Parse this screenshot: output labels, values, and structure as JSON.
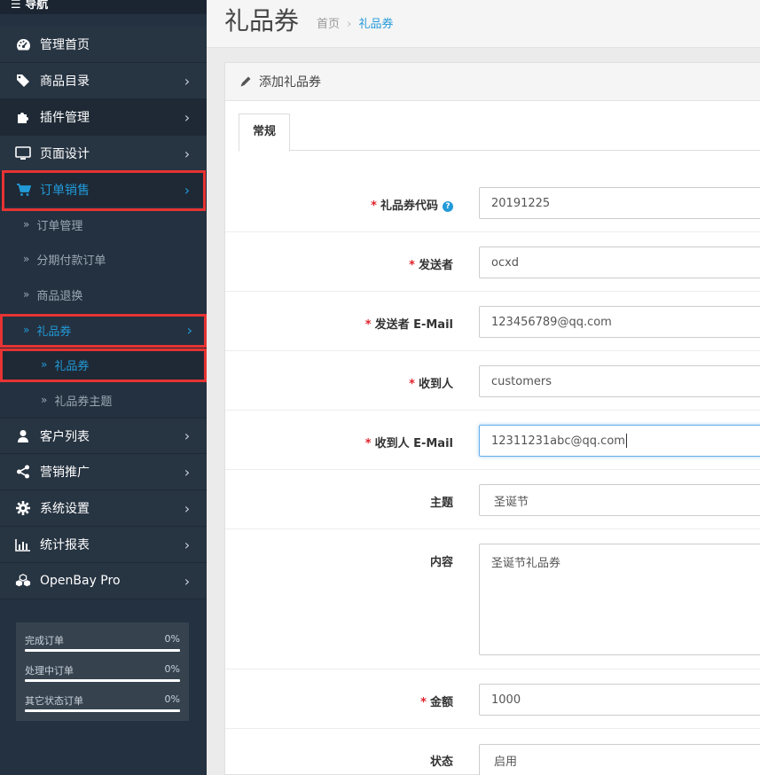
{
  "nav": {
    "title": "导航",
    "items": [
      {
        "label": "管理首页",
        "icon": "dashboard-icon"
      },
      {
        "label": "商品目录",
        "icon": "tags-icon"
      },
      {
        "label": "插件管理",
        "icon": "puzzle-icon"
      },
      {
        "label": "页面设计",
        "icon": "desktop-icon"
      },
      {
        "label": "订单销售",
        "icon": "cart-icon"
      },
      {
        "label": "客户列表",
        "icon": "user-icon"
      },
      {
        "label": "营销推广",
        "icon": "share-icon"
      },
      {
        "label": "系统设置",
        "icon": "cog-icon"
      },
      {
        "label": "统计报表",
        "icon": "bar-chart-icon"
      },
      {
        "label": "OpenBay Pro",
        "icon": "cubes-icon"
      }
    ],
    "sales_sub": [
      "订单管理",
      "分期付款订单",
      "商品退换",
      "礼品券"
    ],
    "voucher_sub": [
      "礼品券",
      "礼品券主题"
    ]
  },
  "stats": [
    {
      "label": "完成订单",
      "value": "0%"
    },
    {
      "label": "处理中订单",
      "value": "0%"
    },
    {
      "label": "其它状态订单",
      "value": "0%"
    }
  ],
  "header": {
    "title": "礼品券",
    "breadcrumb": [
      "首页",
      "礼品券"
    ]
  },
  "panel": {
    "title": "添加礼品券",
    "tab": "常规"
  },
  "form": {
    "code": {
      "label": "礼品券代码",
      "value": "20191225"
    },
    "from_name": {
      "label": "发送者",
      "value": "ocxd"
    },
    "from_email": {
      "label": "发送者 E-Mail",
      "value": "123456789@qq.com"
    },
    "to_name": {
      "label": "收到人",
      "value": "customers"
    },
    "to_email": {
      "label": "收到人 E-Mail",
      "value": "12311231abc@qq.com"
    },
    "theme": {
      "label": "主题",
      "value": "圣诞节"
    },
    "message": {
      "label": "内容",
      "value": "圣诞节礼品券"
    },
    "amount": {
      "label": "金额",
      "value": "1000"
    },
    "status": {
      "label": "状态",
      "value": "启用"
    }
  },
  "colors": {
    "accent": "#229ad8",
    "required": "#e0222c",
    "highlight": "#e63333",
    "sidebar": "#243140"
  }
}
